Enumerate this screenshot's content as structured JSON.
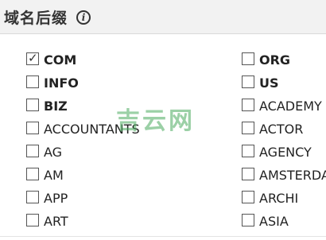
{
  "header": {
    "title": "域名后缀",
    "info_icon": "info-icon"
  },
  "watermark": "吉云网",
  "left_column": [
    {
      "label": "COM",
      "checked": true,
      "bold": true
    },
    {
      "label": "INFO",
      "checked": false,
      "bold": true
    },
    {
      "label": "BIZ",
      "checked": false,
      "bold": true
    },
    {
      "label": "ACCOUNTANTS",
      "checked": false,
      "bold": false
    },
    {
      "label": "AG",
      "checked": false,
      "bold": false
    },
    {
      "label": "AM",
      "checked": false,
      "bold": false
    },
    {
      "label": "APP",
      "checked": false,
      "bold": false
    },
    {
      "label": "ART",
      "checked": false,
      "bold": false
    }
  ],
  "right_column": [
    {
      "label": "ORG",
      "checked": false,
      "bold": true
    },
    {
      "label": "US",
      "checked": false,
      "bold": true
    },
    {
      "label": "ACADEMY",
      "checked": false,
      "bold": false
    },
    {
      "label": "ACTOR",
      "checked": false,
      "bold": false
    },
    {
      "label": "AGENCY",
      "checked": false,
      "bold": false
    },
    {
      "label": "AMSTERDAM",
      "checked": false,
      "bold": false
    },
    {
      "label": "ARCHI",
      "checked": false,
      "bold": false
    },
    {
      "label": "ASIA",
      "checked": false,
      "bold": false
    }
  ]
}
